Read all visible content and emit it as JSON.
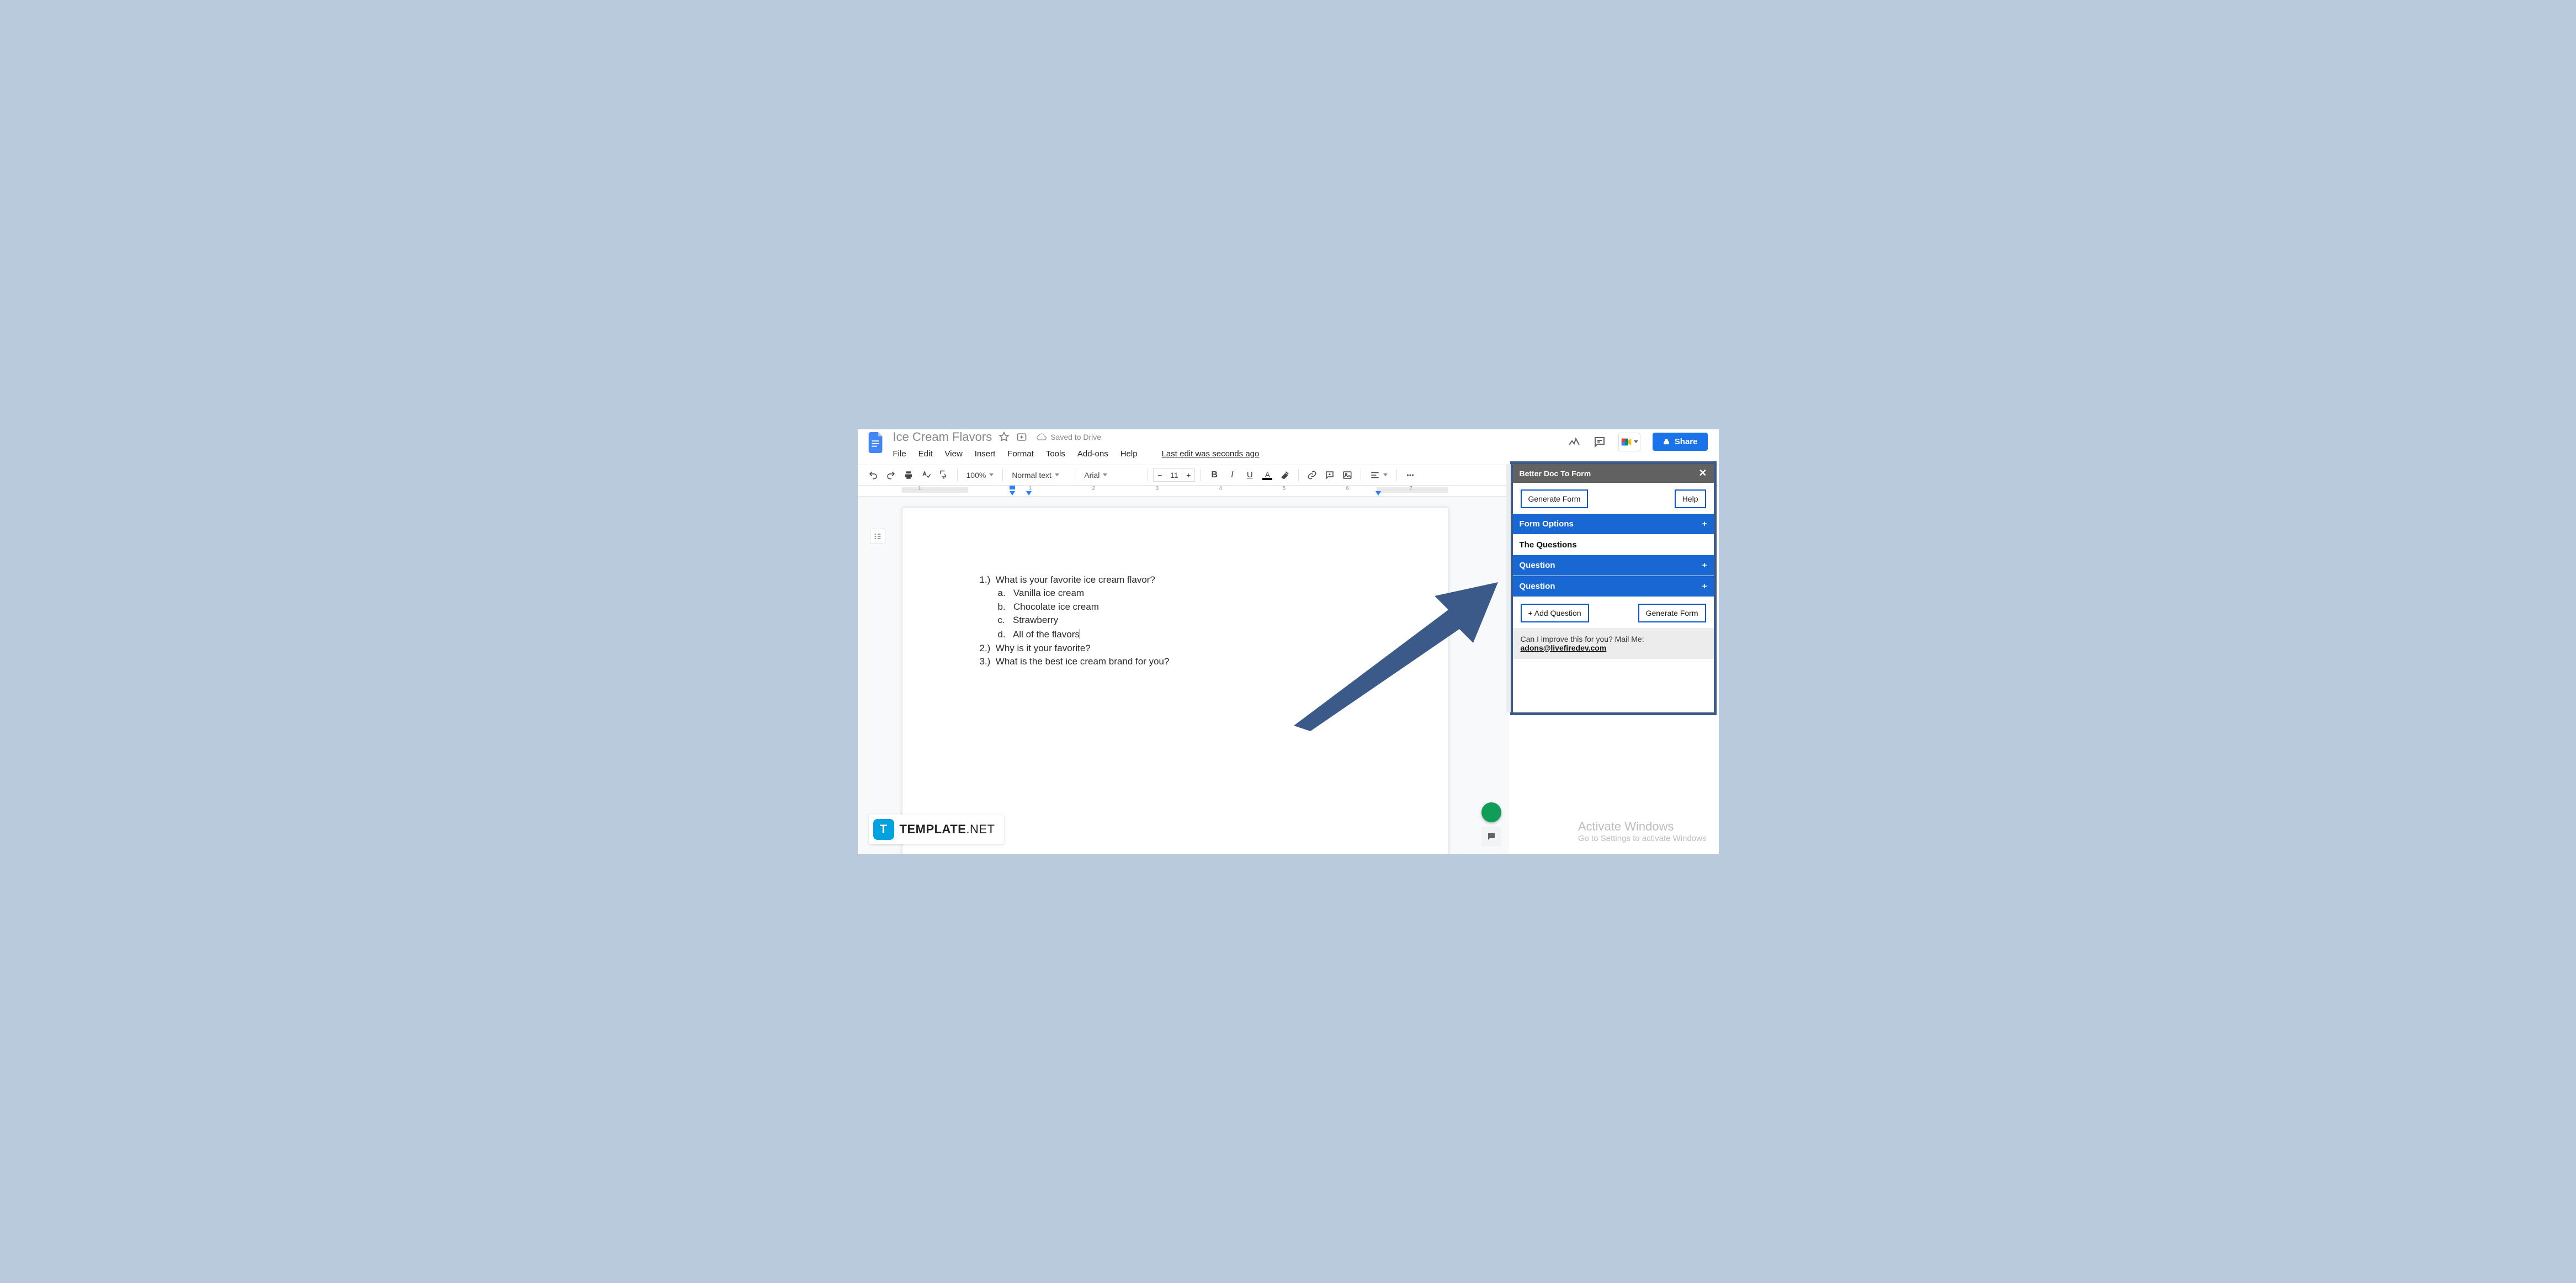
{
  "header": {
    "doc_title": "Ice Cream Flavors",
    "saved_status": "Saved to Drive",
    "menus": [
      "File",
      "Edit",
      "View",
      "Insert",
      "Format",
      "Tools",
      "Add-ons",
      "Help"
    ],
    "last_edit": "Last edit was seconds ago",
    "share_label": "Share"
  },
  "toolbar": {
    "zoom": "100%",
    "style": "Normal text",
    "font": "Arial",
    "font_size": "11"
  },
  "ruler": {
    "numbers": [
      "1",
      "1",
      "2",
      "3",
      "4",
      "5",
      "6",
      "7"
    ]
  },
  "document": {
    "lines": [
      "1.)  What is your favorite ice cream flavor?",
      "       a.   Vanilla ice cream",
      "       b.   Chocolate ice cream",
      "       c.   Strawberry",
      "       d.   All of the flavors",
      "2.)  Why is it your favorite?",
      "3.)  What is the best ice cream brand for you?"
    ]
  },
  "addon": {
    "title": "Better Doc To Form",
    "generate": "Generate Form",
    "help": "Help",
    "form_options": "Form Options",
    "the_questions": "The Questions",
    "question": "Question",
    "add_question": "+ Add Question",
    "generate2": "Generate Form",
    "footer_text": "Can I improve this for you? Mail Me:",
    "footer_email": "adons@livefiredev.com"
  },
  "activate": {
    "line1": "Activate Windows",
    "line2": "Go to Settings to activate Windows"
  },
  "branding": {
    "badge_letter": "T",
    "text_bold": "TEMPLATE",
    "text_thin": ".NET"
  }
}
